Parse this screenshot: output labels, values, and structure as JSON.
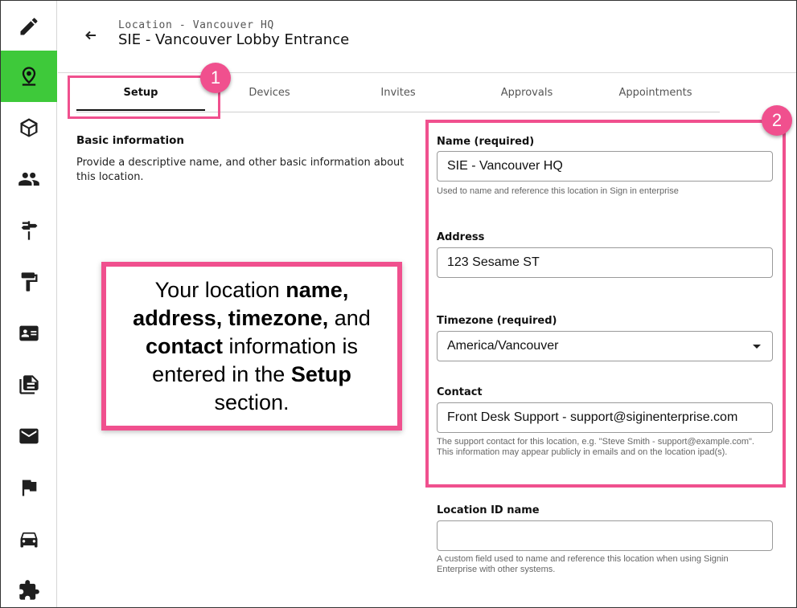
{
  "sidebar": {
    "items": [
      {
        "icon": "pencil-icon",
        "active": false
      },
      {
        "icon": "location-pin-icon",
        "active": true
      },
      {
        "icon": "package-icon",
        "active": false
      },
      {
        "icon": "people-icon",
        "active": false
      },
      {
        "icon": "signpost-icon",
        "active": false
      },
      {
        "icon": "paint-roller-icon",
        "active": false
      },
      {
        "icon": "id-card-icon",
        "active": false
      },
      {
        "icon": "documents-icon",
        "active": false
      },
      {
        "icon": "mail-icon",
        "active": false
      },
      {
        "icon": "flag-icon",
        "active": false
      },
      {
        "icon": "car-icon",
        "active": false
      },
      {
        "icon": "puzzle-icon",
        "active": false
      }
    ],
    "active_color": "#3ec93a"
  },
  "header": {
    "breadcrumb": "Location - Vancouver HQ",
    "title": "SIE - Vancouver Lobby Entrance"
  },
  "tabs": [
    {
      "label": "Setup",
      "active": true
    },
    {
      "label": "Devices",
      "active": false
    },
    {
      "label": "Invites",
      "active": false
    },
    {
      "label": "Approvals",
      "active": false
    },
    {
      "label": "Appointments",
      "active": false
    }
  ],
  "basic_info": {
    "heading": "Basic information",
    "description": "Provide a descriptive name, and other basic information about this location."
  },
  "form": {
    "name": {
      "label": "Name (required)",
      "value": "SIE - Vancouver HQ",
      "help": "Used to name and reference this location in Sign in enterprise"
    },
    "address": {
      "label": "Address",
      "value": "123 Sesame ST"
    },
    "timezone": {
      "label": "Timezone (required)",
      "value": "America/Vancouver"
    },
    "contact": {
      "label": "Contact",
      "value": "Front Desk Support - support@siginenterprise.com",
      "help": "The support contact for this location, e.g. \"Steve Smith - support@example.com\". This information may appear publicly in emails and on the location ipad(s)."
    },
    "location_id": {
      "label": "Location ID name",
      "value": "",
      "help": "A custom field used to name and reference this location when using Signin Enterprise with other systems."
    }
  },
  "annotations": {
    "accent_color": "#f0508e",
    "badge_1": "1",
    "badge_2": "2",
    "callout": {
      "t1": "Your location ",
      "b1": "name,",
      "b2": "address, timezone,",
      "t2": " and ",
      "b3": "contact",
      "t3": " information is entered in the ",
      "b4": "Setup",
      "t4": " section."
    }
  }
}
